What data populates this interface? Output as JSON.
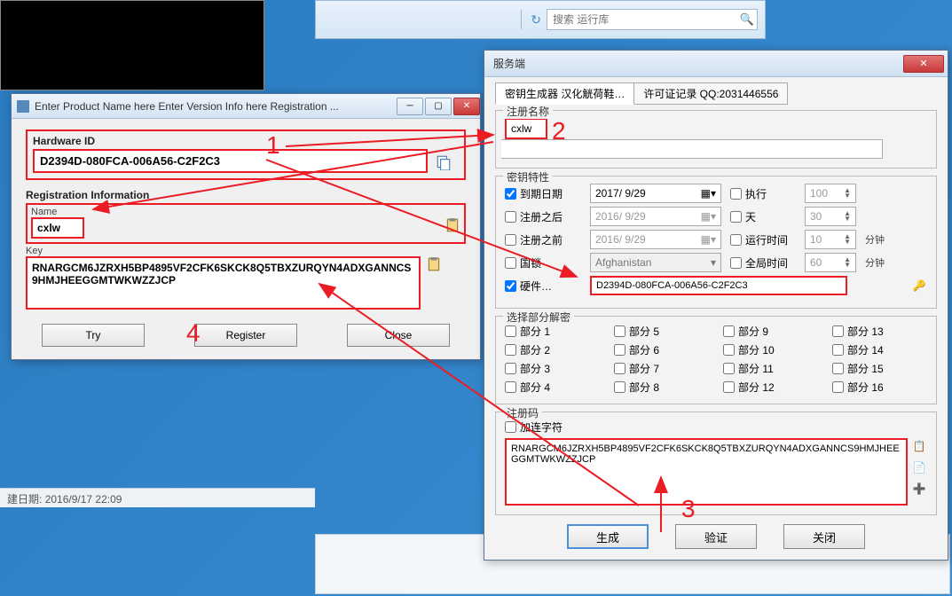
{
  "toolbar": {
    "search_placeholder": "搜索 运行库"
  },
  "status_bar": {
    "created_label": "建日期:",
    "created_value": "2016/9/17 22:09"
  },
  "reg_dialog": {
    "title": "Enter Product Name here Enter Version Info here Registration ...",
    "hwid_label": "Hardware ID",
    "hwid_value": "D2394D-080FCA-006A56-C2F2C3",
    "reginfo_label": "Registration Information",
    "name_label": "Name",
    "name_value": "cxlw",
    "key_label": "Key",
    "key_value": "RNARGCM6JZRXH5BP4895VF2CFK6SKCK8Q5TBXZURQYN4ADXGANNCS9HMJHEEGGMTWKWZZJCP",
    "buttons": {
      "try": "Try",
      "register": "Register",
      "close": "Close"
    }
  },
  "srv_dialog": {
    "title": "服务端",
    "tabs": {
      "keygen": "密钥生成器    汉化觥荷鞋…",
      "license": "许可证记录 QQ:2031446556"
    },
    "reg_name": {
      "legend": "注册名称",
      "value": "cxlw"
    },
    "key_props": {
      "legend": "密钥特性",
      "expire_label": "到期日期",
      "expire_value": "2017/ 9/29",
      "after_label": "注册之后",
      "after_value": "2016/ 9/29",
      "before_label": "注册之前",
      "before_value": "2016/ 9/29",
      "lock_label": "国锁",
      "lock_value": "Afghanistan",
      "hwid_label": "硬件…",
      "hwid_value": "D2394D-080FCA-006A56-C2F2C3",
      "exec_label": "执行",
      "exec_value": "100",
      "days_label": "天",
      "days_value": "30",
      "runtime_label": "运行时间",
      "runtime_value": "10",
      "globaltime_label": "全局时间",
      "globaltime_value": "60",
      "unit_minute": "分钟"
    },
    "parts": {
      "legend": "选择部分解密",
      "prefix": "部分"
    },
    "regcode": {
      "legend": "注册码",
      "addconn_label": "加连字符",
      "value": "RNARGCM6JZRXH5BP4895VF2CFK6SKCK8Q5TBXZURQYN4ADXGANNCS9HMJHEEGGMTWKWZZJCP"
    },
    "buttons": {
      "generate": "生成",
      "verify": "验证",
      "close": "关闭"
    }
  },
  "annotations": {
    "n1": "1",
    "n2": "2",
    "n3": "3",
    "n4": "4"
  }
}
